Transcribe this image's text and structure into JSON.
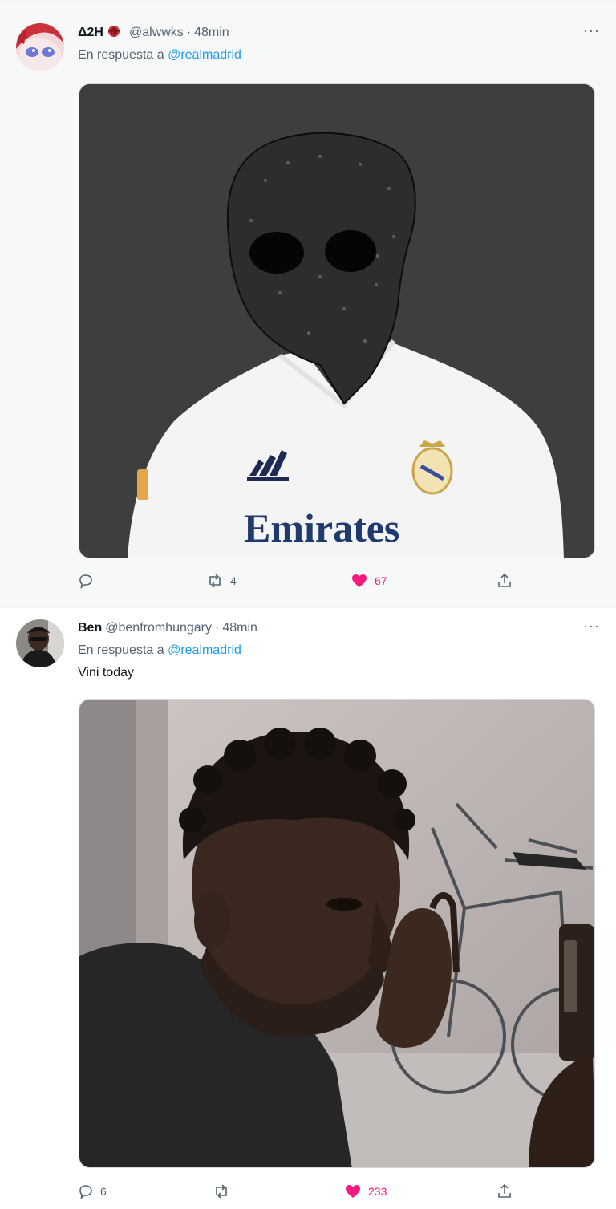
{
  "tweets": [
    {
      "name": "Δ2H",
      "badge_icon": "red-emblem-icon",
      "handle": "@alwwks",
      "time": "48min",
      "reply_prefix": "En respuesta a",
      "reply_mention": "@realmadrid",
      "text": "",
      "media": {
        "kind": "image",
        "shirt_text": "Emirates"
      },
      "stats": {
        "replies": "",
        "retweets": "4",
        "likes": "67"
      },
      "liked": true
    },
    {
      "name": "Ben",
      "handle": "@benfromhungary",
      "time": "48min",
      "reply_prefix": "En respuesta a",
      "reply_mention": "@realmadrid",
      "text": "Vini today",
      "media": {
        "kind": "image"
      },
      "stats": {
        "replies": "6",
        "retweets": "",
        "likes": "233"
      },
      "liked": true
    }
  ],
  "colors": {
    "accent": "#1d9bf0",
    "like": "#f91880",
    "muted": "#536471"
  },
  "icons": [
    "reply-icon",
    "retweet-icon",
    "like-icon",
    "share-icon",
    "more-icon"
  ]
}
